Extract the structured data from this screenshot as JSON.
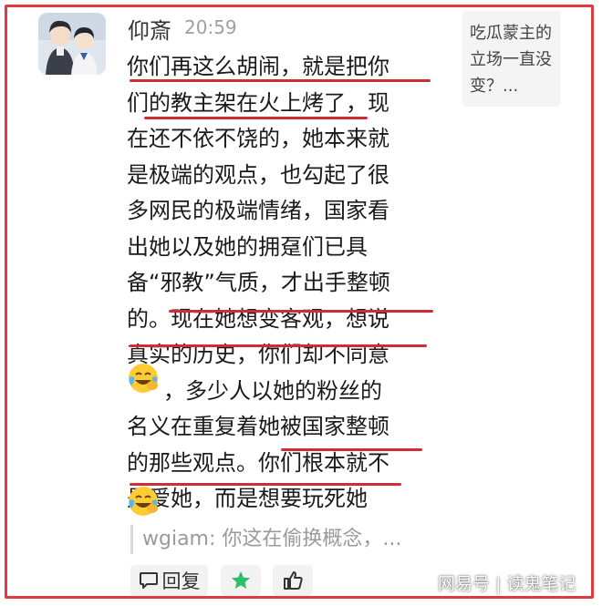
{
  "header": {
    "username": "仰斎",
    "time": "20:59"
  },
  "side_card": {
    "text": "吃瓜蒙主的立场一直没变？..."
  },
  "comment": {
    "lines": [
      "你们再这么胡闹，就是把你",
      "们的教主架在火上烤了，现",
      "在还不依不饶的，她本来就",
      "是极端的观点，也勾起了很",
      "多网民的极端情绪，国家看",
      "出她以及她的拥趸们已具",
      "备“邪教”气质，才出手整顿",
      "的。现在她想变客观，想说",
      "真实的历史，你们却不同意",
      "，多少人以她的粉丝的",
      "名义在重复着她被国家整顿",
      "的那些观点。你们根本就不",
      "是爱她，而是想要玩死她"
    ],
    "emoji": "face-with-tears-of-joy-icon",
    "underline_color": "#cf2d35"
  },
  "reply_quote": {
    "text": "wgiam: 你这在偷换概念，..."
  },
  "actions": {
    "reply_label": "回复"
  },
  "watermark": {
    "text": "网易号 | 读鬼笔记"
  },
  "colors": {
    "frame": "#e0393e",
    "star": "#2bbf6a",
    "text": "#1a1a1a",
    "muted": "#9a9a9a"
  }
}
